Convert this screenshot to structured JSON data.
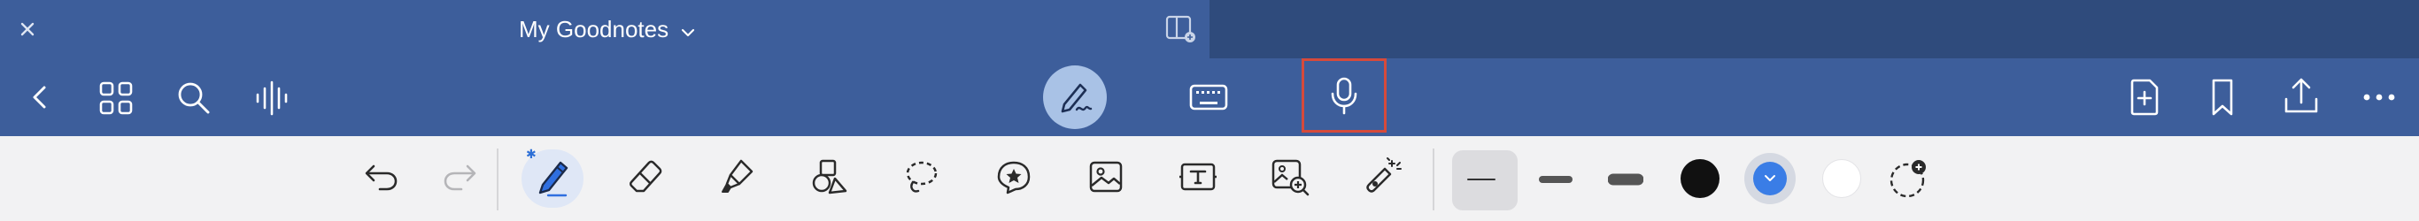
{
  "titlebar": {
    "document_title": "My Goodnotes",
    "icons": [
      "close-icon",
      "chevron-down-icon",
      "split-view-icon"
    ]
  },
  "toolbar": {
    "left_icons": [
      "back-icon",
      "grid-icon",
      "search-icon",
      "audio-wave-icon"
    ],
    "mode_icons": [
      "pen-mode-icon",
      "keyboard-icon",
      "microphone-icon"
    ],
    "right_icons": [
      "add-page-icon",
      "bookmark-icon",
      "share-icon",
      "more-icon"
    ]
  },
  "tools": {
    "items": [
      "undo",
      "redo",
      "pen",
      "eraser",
      "highlighter",
      "shapes",
      "lasso",
      "elements",
      "image",
      "text",
      "image-search",
      "laser-pointer"
    ],
    "active_tool": "pen",
    "bluetooth_glyph": "✱"
  },
  "pen_options": {
    "stroke_widths": [
      "thin",
      "medium",
      "thick"
    ],
    "selected_width": "thin",
    "colors": [
      "#111111",
      "#3a7de6",
      "#ffffff"
    ],
    "selected_color": "#3a7de6",
    "add_color_icon": "add-color-icon"
  }
}
